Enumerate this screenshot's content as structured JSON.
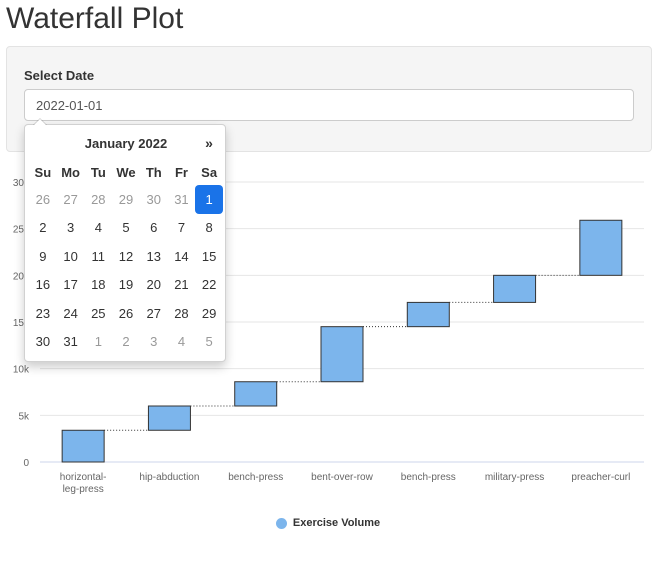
{
  "page": {
    "title": "Waterfall Plot"
  },
  "filter": {
    "label": "Select Date",
    "value": "2022-01-01"
  },
  "datepicker": {
    "month_label": "January 2022",
    "prev_arrow": "«",
    "next_arrow": "»",
    "weekdays": [
      "Su",
      "Mo",
      "Tu",
      "We",
      "Th",
      "Fr",
      "Sa"
    ],
    "weeks": [
      [
        {
          "d": "26",
          "m": "old"
        },
        {
          "d": "27",
          "m": "old"
        },
        {
          "d": "28",
          "m": "old"
        },
        {
          "d": "29",
          "m": "old"
        },
        {
          "d": "30",
          "m": "old"
        },
        {
          "d": "31",
          "m": "old"
        },
        {
          "d": "1",
          "m": "active"
        }
      ],
      [
        {
          "d": "2",
          "m": ""
        },
        {
          "d": "3",
          "m": ""
        },
        {
          "d": "4",
          "m": ""
        },
        {
          "d": "5",
          "m": ""
        },
        {
          "d": "6",
          "m": ""
        },
        {
          "d": "7",
          "m": ""
        },
        {
          "d": "8",
          "m": ""
        }
      ],
      [
        {
          "d": "9",
          "m": ""
        },
        {
          "d": "10",
          "m": ""
        },
        {
          "d": "11",
          "m": ""
        },
        {
          "d": "12",
          "m": ""
        },
        {
          "d": "13",
          "m": ""
        },
        {
          "d": "14",
          "m": ""
        },
        {
          "d": "15",
          "m": ""
        }
      ],
      [
        {
          "d": "16",
          "m": ""
        },
        {
          "d": "17",
          "m": ""
        },
        {
          "d": "18",
          "m": ""
        },
        {
          "d": "19",
          "m": ""
        },
        {
          "d": "20",
          "m": ""
        },
        {
          "d": "21",
          "m": ""
        },
        {
          "d": "22",
          "m": ""
        }
      ],
      [
        {
          "d": "23",
          "m": ""
        },
        {
          "d": "24",
          "m": ""
        },
        {
          "d": "25",
          "m": ""
        },
        {
          "d": "26",
          "m": ""
        },
        {
          "d": "27",
          "m": ""
        },
        {
          "d": "28",
          "m": ""
        },
        {
          "d": "29",
          "m": ""
        }
      ],
      [
        {
          "d": "30",
          "m": ""
        },
        {
          "d": "31",
          "m": ""
        },
        {
          "d": "1",
          "m": "new"
        },
        {
          "d": "2",
          "m": "new"
        },
        {
          "d": "3",
          "m": "new"
        },
        {
          "d": "4",
          "m": "new"
        },
        {
          "d": "5",
          "m": "new"
        }
      ]
    ]
  },
  "colors": {
    "accent": "#1a73e8",
    "bar": "#7cb5ec",
    "grid": "#e6e6e6",
    "axis": "#ccd6eb",
    "connector": "#333333"
  },
  "chart_data": {
    "type": "waterfall",
    "title": "",
    "xlabel": "",
    "ylabel": "",
    "ylim": [
      0,
      30000
    ],
    "yticks": [
      0,
      5000,
      10000,
      15000,
      20000,
      25000,
      30000
    ],
    "ytick_labels": [
      "0",
      "5k",
      "10k",
      "15k",
      "20k",
      "25k",
      "30k"
    ],
    "grid": true,
    "legend": "bottom-center",
    "categories": [
      "horizontal-leg-press",
      "hip-abduction",
      "bench-press",
      "bent-over-row",
      "bench-press",
      "military-press",
      "preacher-curl"
    ],
    "category_labels": [
      [
        "horizontal-",
        "leg-press"
      ],
      [
        "hip-abduction"
      ],
      [
        "bench-press"
      ],
      [
        "bent-over-row"
      ],
      [
        "bench-press"
      ],
      [
        "military-press"
      ],
      [
        "preacher-curl"
      ]
    ],
    "series": [
      {
        "name": "Exercise Volume",
        "values": [
          3400,
          2600,
          2600,
          5900,
          2600,
          2900,
          5900
        ]
      }
    ]
  }
}
